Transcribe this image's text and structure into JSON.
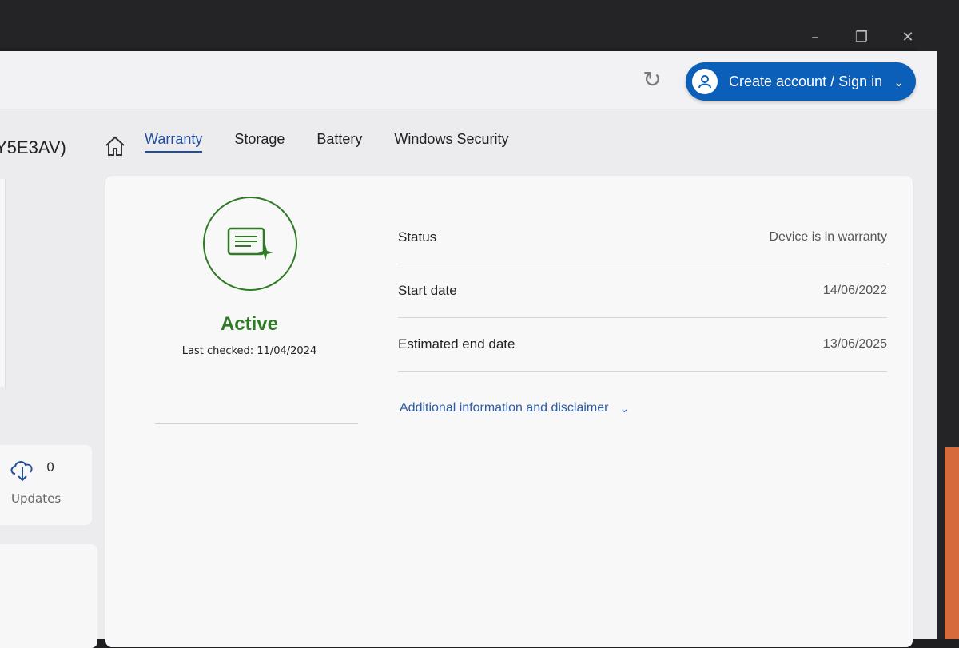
{
  "window": {
    "minimize_icon": "minimize-icon",
    "maximize_icon": "maximize-icon",
    "close_icon": "close-icon"
  },
  "header": {
    "signin_label": "Create account / Sign in",
    "refresh_icon": "refresh-icon",
    "avatar_icon": "user-icon"
  },
  "device": {
    "id_fragment": "Y5E3AV)"
  },
  "nav": {
    "tabs": [
      {
        "label": "Warranty",
        "active": true
      },
      {
        "label": "Storage",
        "active": false
      },
      {
        "label": "Battery",
        "active": false
      },
      {
        "label": "Windows Security",
        "active": false
      }
    ]
  },
  "sidebar": {
    "updates_count": "0",
    "updates_label": "Updates"
  },
  "warranty": {
    "status_word": "Active",
    "last_checked": "Last checked: 11/04/2024",
    "rows": [
      {
        "label": "Status",
        "value": "Device is in warranty"
      },
      {
        "label": "Start date",
        "value": "14/06/2022"
      },
      {
        "label": "Estimated end date",
        "value": "13/06/2025"
      }
    ],
    "more_label": "Additional information and disclaimer"
  },
  "colors": {
    "accent": "#0b5fb8",
    "active_green": "#2f7a24",
    "link_blue": "#2a5ba8"
  }
}
